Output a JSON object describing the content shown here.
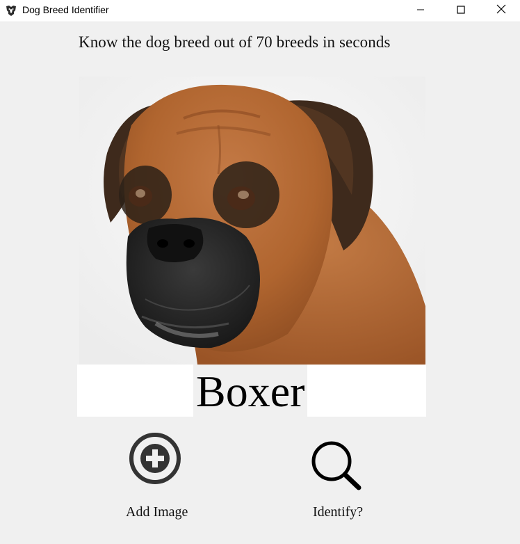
{
  "window": {
    "title": "Dog Breed Identifier",
    "icon": "dog-icon",
    "controls": {
      "minimize_icon": "minimize-icon",
      "maximize_icon": "maximize-icon",
      "close_icon": "close-icon"
    }
  },
  "main": {
    "tagline": "Know the dog breed out of 70 breeds in seconds",
    "photo_subject": "dog-photo",
    "result": "Boxer"
  },
  "actions": {
    "add": {
      "label": "Add Image",
      "icon": "add-circle-icon"
    },
    "identify": {
      "label": "Identify?",
      "icon": "search-icon"
    }
  },
  "colors": {
    "background": "#f0f0f0",
    "titlebar": "#ffffff",
    "icon_dark": "#333333"
  }
}
